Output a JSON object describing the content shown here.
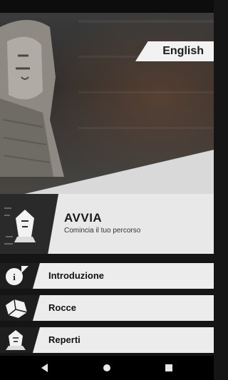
{
  "language_button": {
    "label": "English"
  },
  "start": {
    "title": "AVVIA",
    "subtitle": "Comincia il tuo percorso"
  },
  "menu": [
    {
      "label": "Introduzione",
      "icon": "info-icon"
    },
    {
      "label": "Rocce",
      "icon": "rock-icon"
    },
    {
      "label": "Reperti",
      "icon": "sphinx-icon"
    }
  ],
  "navigation": {
    "back_icon": "back-triangle-icon",
    "home_icon": "home-circle-icon",
    "recents_icon": "recents-square-icon"
  },
  "colors": {
    "accent_light": "#ececec",
    "accent_dark": "#1e1e1e"
  }
}
